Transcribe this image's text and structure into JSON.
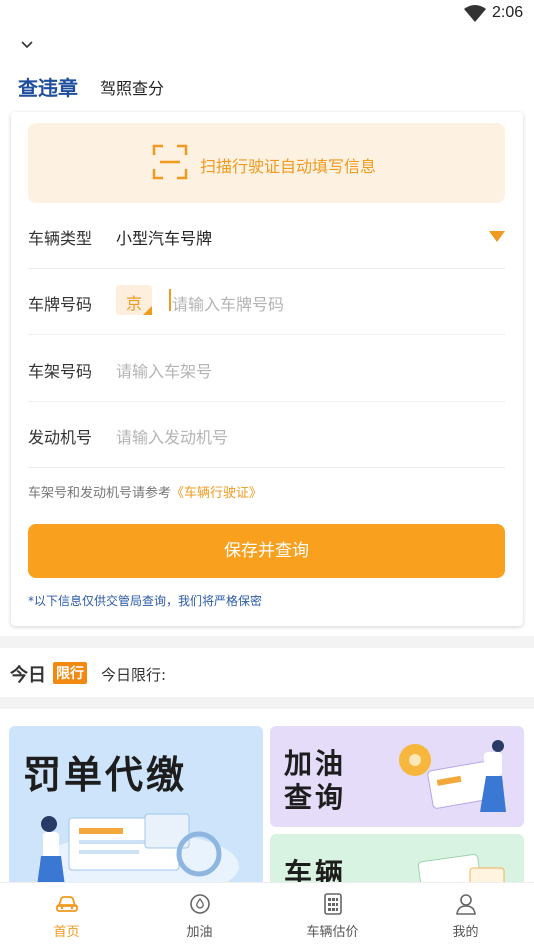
{
  "status_bar": {
    "time": "2:06"
  },
  "tabs": {
    "active": "查违章",
    "inactive": "驾照查分"
  },
  "scan": {
    "label": "扫描行驶证自动填写信息"
  },
  "form": {
    "vehicle_type": {
      "label": "车辆类型",
      "value": "小型汽车号牌"
    },
    "plate_number": {
      "label": "车牌号码",
      "province": "京",
      "placeholder": "请输入车牌号码"
    },
    "frame_number": {
      "label": "车架号码",
      "placeholder": "请输入车架号"
    },
    "engine_number": {
      "label": "发动机号",
      "placeholder": "请输入发动机号"
    },
    "hint_prefix": "车架号和发动机号请参考",
    "hint_link": "《车辆行驶证》",
    "submit_label": "保存并查询",
    "privacy_note": "*以下信息仅供交管局查询，我们将严格保密"
  },
  "today": {
    "title": "今日",
    "badge": "限行",
    "text": "今日限行:"
  },
  "banners": {
    "fine_payment": "罚单代缴",
    "fuel_line1": "加油",
    "fuel_line2": "查询",
    "vehicle": "车辆"
  },
  "bottom_nav": [
    {
      "label": "首页",
      "icon": "car-icon",
      "active": true
    },
    {
      "label": "加油",
      "icon": "fuel-drop-icon",
      "active": false
    },
    {
      "label": "车辆估价",
      "icon": "calculator-icon",
      "active": false
    },
    {
      "label": "我的",
      "icon": "user-icon",
      "active": false
    }
  ],
  "colors": {
    "accent": "#f9a01e",
    "tab_active": "#1f4e9c",
    "link_blue": "#2b5aa8"
  }
}
